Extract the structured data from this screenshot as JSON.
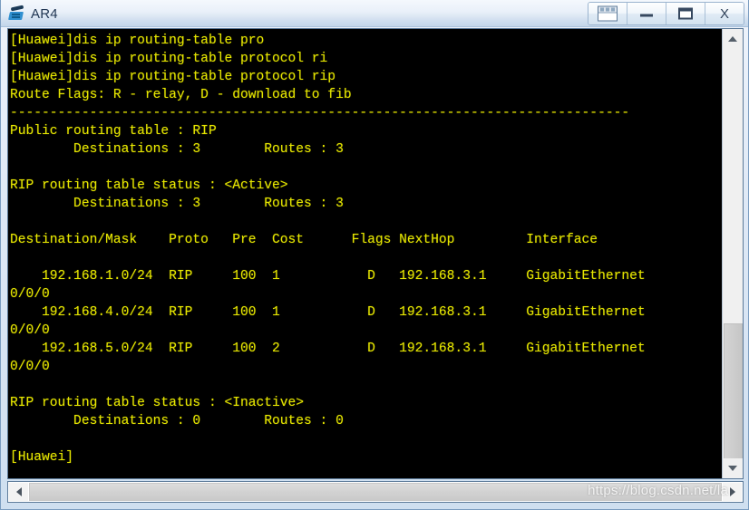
{
  "window": {
    "title": "AR4",
    "icon": "router-switch-icon",
    "buttons": [
      {
        "name": "restore-layout-button",
        "label": ""
      },
      {
        "name": "minimize-button",
        "label": ""
      },
      {
        "name": "maximize-button",
        "label": ""
      },
      {
        "name": "close-button",
        "label": "X"
      }
    ]
  },
  "terminal": {
    "foreground_color": "#e5e500",
    "background_color": "#000000",
    "content": "[Huawei]dis ip routing-table pro\n[Huawei]dis ip routing-table protocol ri\n[Huawei]dis ip routing-table protocol rip\nRoute Flags: R - relay, D - download to fib\n------------------------------------------------------------------------------\nPublic routing table : RIP\n        Destinations : 3        Routes : 3\n\nRIP routing table status : <Active>\n        Destinations : 3        Routes : 3\n\nDestination/Mask    Proto   Pre  Cost      Flags NextHop         Interface\n\n    192.168.1.0/24  RIP     100  1           D   192.168.3.1     GigabitEthernet\n0/0/0\n    192.168.4.0/24  RIP     100  1           D   192.168.3.1     GigabitEthernet\n0/0/0\n    192.168.5.0/24  RIP     100  2           D   192.168.3.1     GigabitEthernet\n0/0/0\n\nRIP routing table status : <Inactive>\n        Destinations : 0        Routes : 0\n\n[Huawei]",
    "lines": [
      "[Huawei]dis ip routing-table pro",
      "[Huawei]dis ip routing-table protocol ri",
      "[Huawei]dis ip routing-table protocol rip",
      "Route Flags: R - relay, D - download to fib",
      "------------------------------------------------------------------------------",
      "Public routing table : RIP",
      "        Destinations : 3        Routes : 3",
      "",
      "RIP routing table status : <Active>",
      "        Destinations : 3        Routes : 3",
      "",
      "Destination/Mask    Proto   Pre  Cost      Flags NextHop         Interface",
      "",
      "    192.168.1.0/24  RIP     100  1           D   192.168.3.1     GigabitEthernet",
      "0/0/0",
      "    192.168.4.0/24  RIP     100  1           D   192.168.3.1     GigabitEthernet",
      "0/0/0",
      "    192.168.5.0/24  RIP     100  2           D   192.168.3.1     GigabitEthernet",
      "0/0/0",
      "",
      "RIP routing table status : <Inactive>",
      "        Destinations : 0        Routes : 0",
      "",
      "[Huawei]"
    ],
    "routing_table": {
      "headers": [
        "Destination/Mask",
        "Proto",
        "Pre",
        "Cost",
        "Flags",
        "NextHop",
        "Interface"
      ],
      "rows": [
        [
          "192.168.1.0/24",
          "RIP",
          "100",
          "1",
          "D",
          "192.168.3.1",
          "GigabitEthernet0/0/0"
        ],
        [
          "192.168.4.0/24",
          "RIP",
          "100",
          "1",
          "D",
          "192.168.3.1",
          "GigabitEthernet0/0/0"
        ],
        [
          "192.168.5.0/24",
          "RIP",
          "100",
          "2",
          "D",
          "192.168.3.1",
          "GigabitEthernet0/0/0"
        ]
      ]
    },
    "prompt": "[Huawei]"
  },
  "scrollbars": {
    "vertical": {
      "up_arrow": "chevron-up-icon",
      "down_arrow": "chevron-down-icon"
    },
    "horizontal": {
      "left_arrow": "chevron-left-icon",
      "right_arrow": "chevron-right-icon"
    }
  },
  "watermark": "https://blog.csdn.net/la"
}
